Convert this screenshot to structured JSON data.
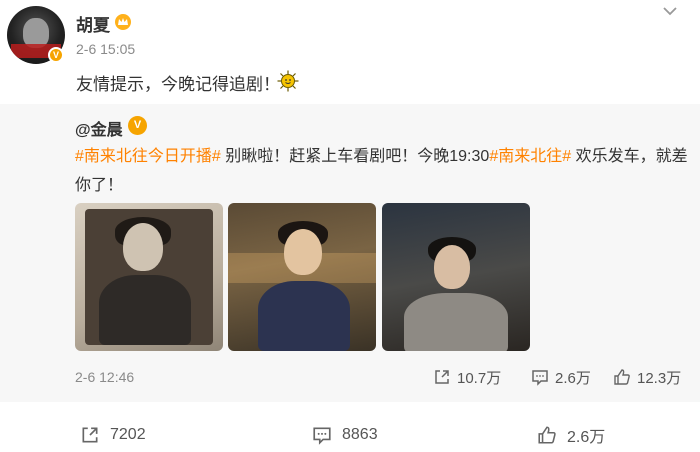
{
  "post": {
    "author": "胡夏",
    "time": "2-6 15:05",
    "text": "友情提示，今晚记得追剧！"
  },
  "repost": {
    "author": "@金晨",
    "line1": {
      "tag1": "#南来北往今日开播#",
      "text1": " 别瞅啦！赶紧上车看剧吧！今晚19:30",
      "tag2": "#南来北往#",
      "text2": " 欢乐发车，就差"
    },
    "line2": "你了！",
    "time": "2-6 12:46",
    "stats": {
      "share": "10.7万",
      "comment": "2.6万",
      "like": "12.3万"
    }
  },
  "actions": {
    "share": "7202",
    "comment": "8863",
    "like": "2.6万"
  },
  "colors": {
    "tag": "#ff8200",
    "badge": "#f6a400",
    "repost_bg": "#f7f7f7"
  }
}
